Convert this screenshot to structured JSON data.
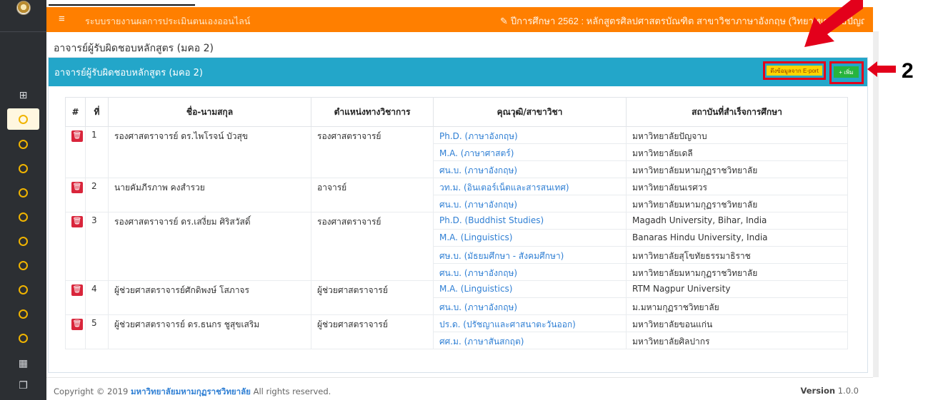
{
  "app": {
    "title": "ระบบรายงานผลการประเมินตนเองออนไลน์",
    "year_info": "ปีการศึกษา 2562 : หลักสูตรศิลปศาสตรบัณฑิต สาขาวิชาภาษาอังกฤษ (วิทยาเขตพุทธปัญญาศรีทวารวดี)",
    "hamburger_glyph": "≡",
    "edit_glyph": "✎"
  },
  "page": {
    "title": "อาจารย์ผู้รับผิดชอบหลักสูตร (มคอ 2)"
  },
  "panel": {
    "title": "อาจารย์ผู้รับผิดชอบหลักสูตร (มคอ 2)",
    "eport_label": "ดึงข้อมูลจาก E-port",
    "add_label": "+ เพิ่ม",
    "header_color": "#23a6c9"
  },
  "table": {
    "headers": [
      "#",
      "ที่",
      "ชื่อ-นามสกุล",
      "ตำแหน่งทางวิชาการ",
      "คุณวุฒิ/สาขาวิชา",
      "สถาบันที่สำเร็จการศึกษา"
    ],
    "rows": [
      {
        "no": "1",
        "name": "รองศาสตราจารย์ ดร.ไพโรจน์ บัวสุข",
        "position": "รองศาสตราจารย์",
        "quals": [
          {
            "degree": "Ph.D. (ภาษาอังกฤษ)",
            "institution": "มหาวิทยาลัยปัญจาบ"
          },
          {
            "degree": "M.A. (ภาษาศาสตร์)",
            "institution": "มหาวิทยาลัยเดลี"
          },
          {
            "degree": "ศน.บ. (ภาษาอังกฤษ)",
            "institution": "มหาวิทยาลัยมหามกุฏราชวิทยาลัย"
          }
        ]
      },
      {
        "no": "2",
        "name": "นายคัมภีรภาพ คงสำรวย",
        "position": "อาจารย์",
        "quals": [
          {
            "degree": "วท.ม. (อินเตอร์เน็ตและสารสนเทศ)",
            "institution": "มหาวิทยาลัยนเรศวร"
          },
          {
            "degree": "ศน.บ. (ภาษาอังกฤษ)",
            "institution": "มหาวิทยาลัยมหามกุฏราชวิทยาลัย"
          }
        ]
      },
      {
        "no": "3",
        "name": "รองศาสตราจารย์ ดร.เสงี่ยม ศิริสวัสดิ์",
        "position": "รองศาสตราจารย์",
        "quals": [
          {
            "degree": "Ph.D. (Buddhist Studies)",
            "institution": "Magadh University, Bihar, India"
          },
          {
            "degree": "M.A. (Linguistics)",
            "institution": "Banaras Hindu University, India"
          },
          {
            "degree": "ศษ.บ. (มัธยมศึกษา - สังคมศึกษา)",
            "institution": "มหาวิทยาลัยสุโขทัยธรรมาธิราช"
          },
          {
            "degree": "ศน.บ. (ภาษาอังกฤษ)",
            "institution": "มหาวิทยาลัยมหามกุฏราชวิทยาลัย"
          }
        ]
      },
      {
        "no": "4",
        "name": "ผู้ช่วยศาสตราจารย์ศักดิพงษ์ โสภาจร",
        "position": "ผู้ช่วยศาสตราจารย์",
        "quals": [
          {
            "degree": "M.A. (Linguistics)",
            "institution": "RTM Nagpur University"
          },
          {
            "degree": "ศน.บ. (ภาษาอังกฤษ)",
            "institution": "ม.มหามกุฏราชวิทยาลัย"
          }
        ]
      },
      {
        "no": "5",
        "name": "ผู้ช่วยศาสตราจารย์ ดร.ธนกร ชูสุขเสริม",
        "position": "ผู้ช่วยศาสตราจารย์",
        "quals": [
          {
            "degree": "ปร.ด. (ปรัชญาและศาสนาตะวันออก)",
            "institution": "มหาวิทยาลัยขอนแก่น"
          },
          {
            "degree": "ศศ.ม. (ภาษาสันสกฤต)",
            "institution": "มหาวิทยาลัยศิลปากร"
          }
        ]
      }
    ]
  },
  "footer": {
    "copyright_prefix": "Copyright © 2019",
    "university": "มหาวิทยาลัยมหามกุฏราชวิทยาลัย",
    "rights": "All rights reserved.",
    "version_label": "Version",
    "version_number": "1.0.0"
  },
  "annotation": {
    "number": "2",
    "arrow_color": "#e3001b"
  }
}
